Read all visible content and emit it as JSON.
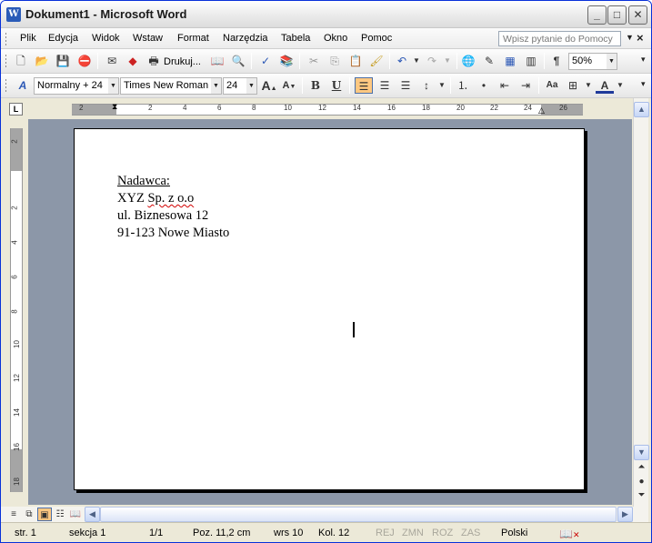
{
  "window": {
    "title": "Dokument1 - Microsoft Word",
    "app_icon": "W"
  },
  "menu": {
    "items": [
      "Plik",
      "Edycja",
      "Widok",
      "Wstaw",
      "Format",
      "Narzędzia",
      "Tabela",
      "Okno",
      "Pomoc"
    ],
    "help_placeholder": "Wpisz pytanie do Pomocy"
  },
  "standard_toolbar": {
    "print_label": "Drukuj...",
    "zoom": "50%"
  },
  "formatting_toolbar": {
    "style": "Normalny + 24",
    "font": "Times New Roman",
    "size": "24"
  },
  "ruler": {
    "h_ticks": [
      "2",
      "2",
      "4",
      "6",
      "8",
      "10",
      "12",
      "14",
      "16",
      "18",
      "20",
      "22",
      "24",
      "26"
    ],
    "v_ticks": [
      "2",
      "2",
      "4",
      "6",
      "8",
      "10",
      "12",
      "14",
      "16",
      "18"
    ]
  },
  "document": {
    "lines": [
      "Nadawca:",
      "XYZ ",
      "Sp. z o.o",
      "ul. Biznesowa 12",
      "91-123 Nowe Miasto"
    ]
  },
  "status": {
    "page": "str. 1",
    "section": "sekcja  1",
    "pages": "1/1",
    "position": "Poz.  11,2 cm",
    "line": "wrs  10",
    "column": "Kol.  12",
    "rec": "REJ",
    "trk": "ZMN",
    "ext": "ROZ",
    "ovr": "ZAS",
    "language": "Polski"
  }
}
